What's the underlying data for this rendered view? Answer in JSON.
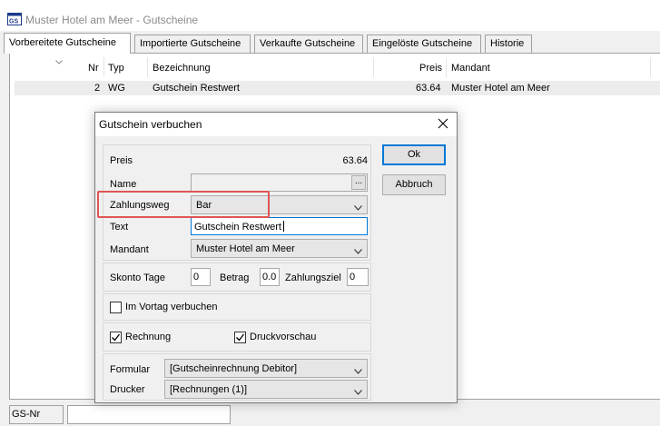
{
  "window": {
    "title": "Muster Hotel am Meer - Gutscheine",
    "icon": "app-window-icon"
  },
  "tabs": [
    {
      "label": "Vorbereitete Gutscheine",
      "active": true
    },
    {
      "label": "Importierte Gutscheine",
      "active": false
    },
    {
      "label": "Verkaufte Gutscheine",
      "active": false
    },
    {
      "label": "Eingelöste Gutscheine",
      "active": false
    },
    {
      "label": "Historie",
      "active": false
    }
  ],
  "list": {
    "columns": {
      "nr": "Nr",
      "typ": "Typ",
      "bezeichnung": "Bezeichnung",
      "preis": "Preis",
      "mandant": "Mandant"
    },
    "rows": [
      {
        "nr": "2",
        "typ": "WG",
        "bezeichnung": "Gutschein Restwert",
        "preis": "63.64",
        "mandant": "Muster Hotel am Meer"
      }
    ]
  },
  "status": {
    "gs_label": "GS-Nr",
    "gs_value": ""
  },
  "dialog": {
    "title": "Gutschein verbuchen",
    "preis_label": "Preis",
    "preis_value": "63.64",
    "name_label": "Name",
    "name_value": "",
    "name_button": "...",
    "zahlungsweg_label": "Zahlungsweg",
    "zahlungsweg_value": "Bar",
    "text_label": "Text",
    "text_value": "Gutschein Restwert",
    "mandant_label": "Mandant",
    "mandant_value": "Muster Hotel am Meer",
    "skonto_tage_label": "Skonto Tage",
    "skonto_tage_value": "0",
    "betrag_label": "Betrag",
    "betrag_value": "0.0",
    "zahlungsziel_label": "Zahlungsziel",
    "zahlungsziel_value": "0",
    "im_vortrag_label": "Im Vortag verbuchen",
    "im_vortrag_checked": false,
    "rechnung_label": "Rechnung",
    "rechnung_checked": true,
    "druckvorschau_label": "Druckvorschau",
    "druckvorschau_checked": true,
    "formular_label": "Formular",
    "formular_value": "[Gutscheinrechnung Debitor]",
    "drucker_label": "Drucker",
    "drucker_value": "[Rechnungen (1)]",
    "ok_label": "Ok",
    "abbruch_label": "Abbruch"
  },
  "colors": {
    "accent": "#0078d7",
    "highlight": "#e05555"
  }
}
